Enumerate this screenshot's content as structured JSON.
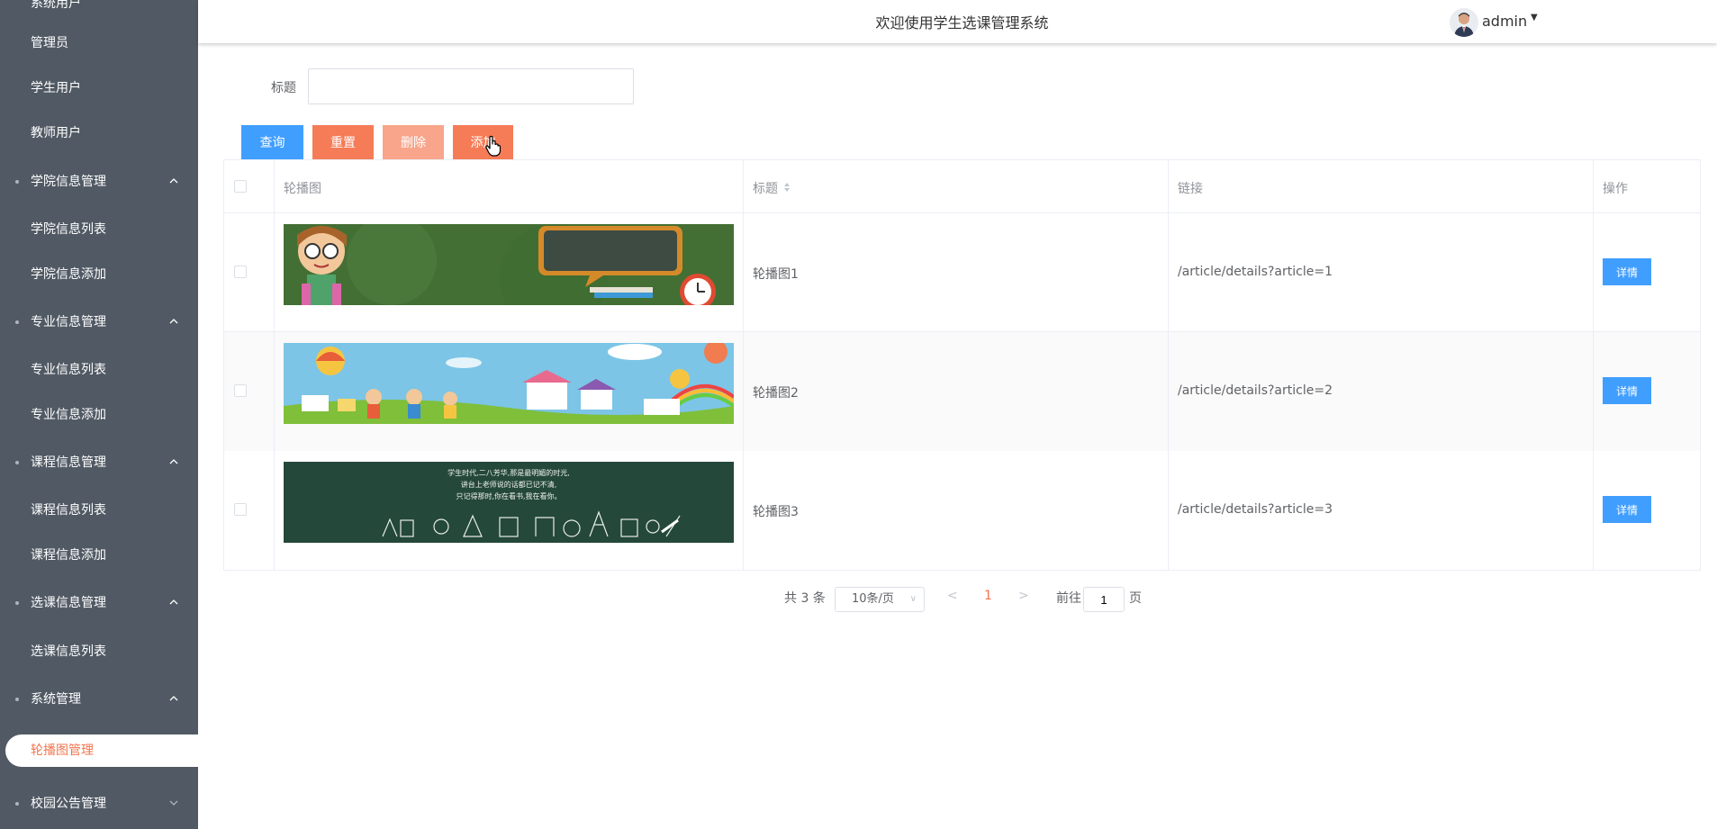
{
  "header": {
    "title": "欢迎使用学生选课管理系统",
    "user": "admin"
  },
  "sidebar": {
    "items": [
      {
        "label": "系统用户"
      },
      {
        "label": "管理员"
      },
      {
        "label": "学生用户"
      },
      {
        "label": "教师用户"
      },
      {
        "label": "学院信息管理"
      },
      {
        "label": "学院信息列表"
      },
      {
        "label": "学院信息添加"
      },
      {
        "label": "专业信息管理"
      },
      {
        "label": "专业信息列表"
      },
      {
        "label": "专业信息添加"
      },
      {
        "label": "课程信息管理"
      },
      {
        "label": "课程信息列表"
      },
      {
        "label": "课程信息添加"
      },
      {
        "label": "选课信息管理"
      },
      {
        "label": "选课信息列表"
      },
      {
        "label": "系统管理"
      },
      {
        "label": "轮播图管理"
      },
      {
        "label": "校园公告管理"
      }
    ]
  },
  "search": {
    "label": "标题",
    "value": "",
    "placeholder": ""
  },
  "toolbar": {
    "query": "查询",
    "reset": "重置",
    "delete": "删除",
    "add": "添加"
  },
  "table": {
    "headers": {
      "image": "轮播图",
      "title": "标题",
      "link": "链接",
      "action": "操作"
    },
    "rows": [
      {
        "title": "轮播图1",
        "link": "/article/details?article=1",
        "action": "详情"
      },
      {
        "title": "轮播图2",
        "link": "/article/details?article=2",
        "action": "详情"
      },
      {
        "title": "轮播图3",
        "link": "/article/details?article=3",
        "action": "详情",
        "banner_text": [
          "学生时代,二八芳华,那是最明媚的时光,",
          "讲台上老师说的话都已记不清,",
          "只记得那时,你在看书,我在看你。"
        ]
      }
    ]
  },
  "pagination": {
    "total": "共 3 条",
    "page_size": "10条/页",
    "current": "1",
    "goto_label": "前往",
    "goto_value": "1",
    "page_suffix": "页"
  },
  "colors": {
    "sidebar_bg": "#515a64",
    "accent": "#f57c57",
    "primary": "#409eff"
  }
}
